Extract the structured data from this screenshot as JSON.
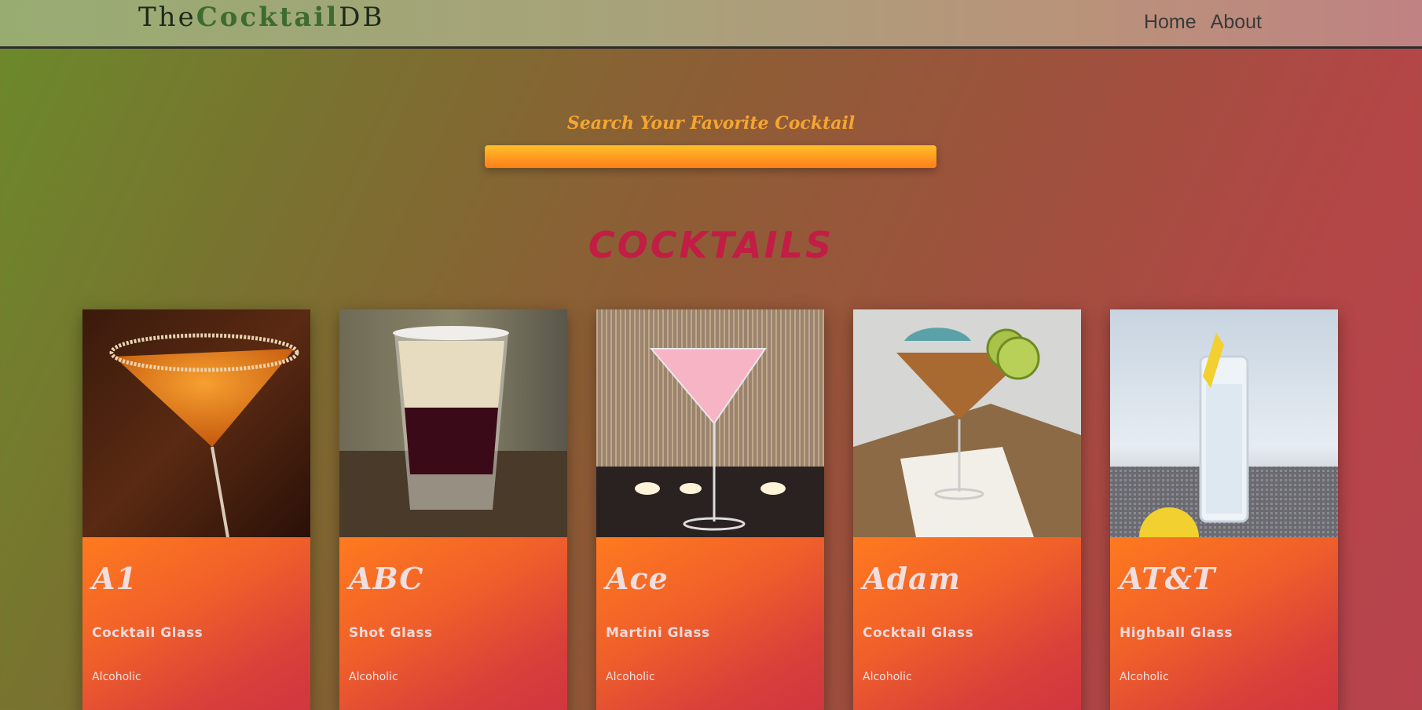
{
  "navbar": {
    "logo_prefix": "The",
    "logo_mid": "Cocktail",
    "logo_suffix": "DB",
    "links": [
      "Home",
      "About"
    ]
  },
  "search": {
    "label": "Search Your Favorite Cocktail",
    "value": "",
    "placeholder": ""
  },
  "section_title": "COCKTAILS",
  "cocktails": [
    {
      "name": "A1",
      "glass": "Cocktail Glass",
      "type": "Alcoholic"
    },
    {
      "name": "ABC",
      "glass": "Shot Glass",
      "type": "Alcoholic"
    },
    {
      "name": "Ace",
      "glass": "Martini Glass",
      "type": "Alcoholic"
    },
    {
      "name": "Adam",
      "glass": "Cocktail Glass",
      "type": "Alcoholic"
    },
    {
      "name": "AT&T",
      "glass": "Highball Glass",
      "type": "Alcoholic"
    }
  ],
  "colors": {
    "accent_orange": "#ff8a1c",
    "title_red": "#c21d45",
    "logo_green": "#3d6b30"
  }
}
